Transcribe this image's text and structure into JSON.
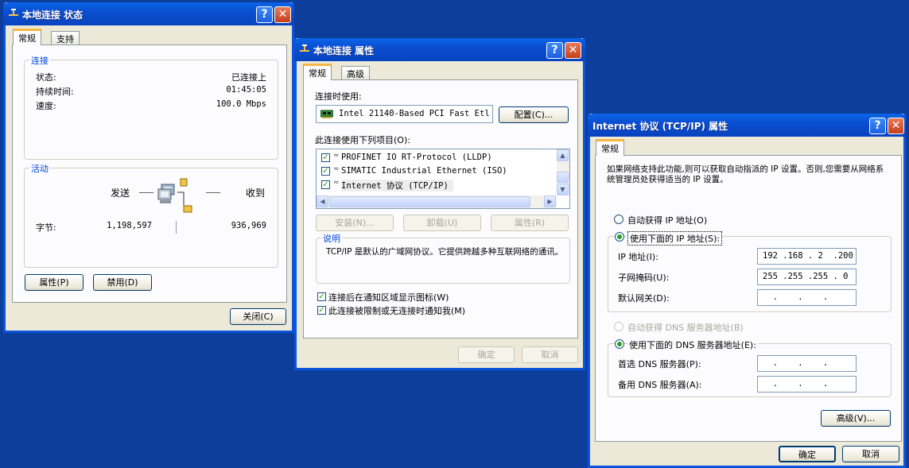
{
  "status_window": {
    "title": "本地连接 状态",
    "tabs": [
      "常规",
      "支持"
    ],
    "connection": {
      "group": "连接",
      "rows": [
        {
          "label": "状态:",
          "value": "已连接上"
        },
        {
          "label": "持续时间:",
          "value": "01:45:05"
        },
        {
          "label": "速度:",
          "value": "100.0 Mbps"
        }
      ]
    },
    "activity": {
      "group": "活动",
      "sent": "发送",
      "received": "收到",
      "bytes_label": "字节:",
      "bytes_sent": "1,198,597",
      "bytes_received": "936,969"
    },
    "properties_button": "属性(P)",
    "disable_button": "禁用(D)",
    "close_button": "关闭(C)"
  },
  "props_window": {
    "title": "本地连接 属性",
    "tabs": [
      "常规",
      "高级"
    ],
    "connect_using": "连接时使用:",
    "adapter": "Intel 21140-Based PCI Fast Etl",
    "configure_button": "配置(C)...",
    "items_label": "此连接使用下列项目(O):",
    "items": [
      {
        "label": "PROFINET IO RT-Protocol (LLDP)",
        "checked": true
      },
      {
        "label": "SIMATIC Industrial Ethernet (ISO)",
        "checked": true
      },
      {
        "label": "Internet 协议 (TCP/IP)",
        "checked": true
      }
    ],
    "install_button": "安装(N)...",
    "uninstall_button": "卸载(U)",
    "properties_button": "属性(R)",
    "description_group": "说明",
    "description": "TCP/IP 是默认的广域网协议。它提供跨越多种互联网络的通讯。",
    "show_icon": {
      "label": "连接后在通知区域显示图标(W)",
      "checked": true
    },
    "notify": {
      "label": "此连接被限制或无连接时通知我(M)",
      "checked": true
    },
    "ok_button": "确定",
    "cancel_button": "取消"
  },
  "tcpip_window": {
    "title": "Internet 协议 (TCP/IP) 属性",
    "tab": "常规",
    "intro": "如果网络支持此功能,则可以获取自动指派的 IP 设置。否则,您需要从网络系统管理员处获得适当的 IP 设置。",
    "auto_ip": "自动获得 IP 地址(O)",
    "use_ip": "使用下面的 IP 地址(S):",
    "ip_label": "IP 地址(I):",
    "ip_value": "192 .168 . 2  .200",
    "mask_label": "子网掩码(U):",
    "mask_value": "255 .255 .255 . 0",
    "gateway_label": "默认网关(D):",
    "gateway_value": "  .    .    .",
    "auto_dns": "自动获得 DNS 服务器地址(B)",
    "use_dns": "使用下面的 DNS 服务器地址(E):",
    "pref_dns_label": "首选 DNS 服务器(P):",
    "pref_dns_value": "  .    .    .",
    "alt_dns_label": "备用 DNS 服务器(A):",
    "alt_dns_value": "  .    .    .",
    "advanced_button": "高级(V)...",
    "ok_button": "确定",
    "cancel_button": "取消"
  },
  "colors": {
    "desktop": "#0e3e9b",
    "title_blue": "#0a55dc",
    "dialog_bg": "#ece9d8",
    "group_label": "#0046d5"
  }
}
